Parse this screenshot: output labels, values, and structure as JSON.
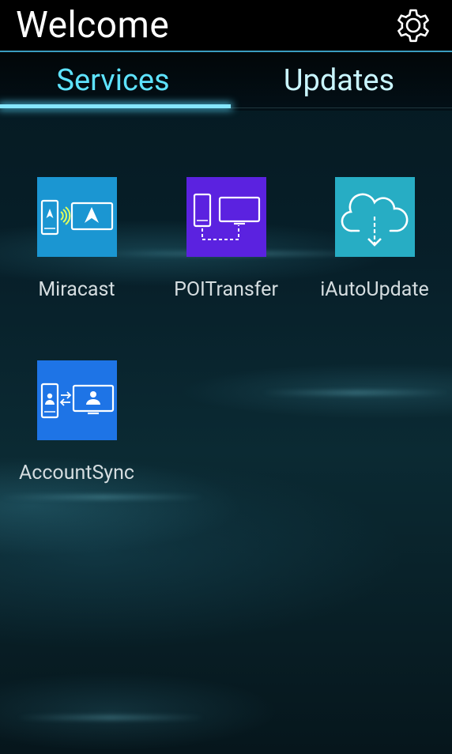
{
  "header": {
    "title": "Welcome",
    "settings_icon": "gear-icon"
  },
  "tabs": [
    {
      "label": "Services",
      "selected": true
    },
    {
      "label": "Updates",
      "selected": false
    }
  ],
  "services": [
    {
      "label": "Miracast",
      "icon": "miracast-icon",
      "color": "#1b96d2"
    },
    {
      "label": "POITransfer",
      "icon": "poi-transfer-icon",
      "color": "#5b22e0"
    },
    {
      "label": "iAutoUpdate",
      "icon": "cloud-download-icon",
      "color": "#27adc4"
    },
    {
      "label": "AccountSync",
      "icon": "account-sync-icon",
      "color": "#1e74e6"
    }
  ],
  "colors": {
    "accent": "#5ee3ff",
    "header_line": "#3a9cc0",
    "tab_indicator": "#86e7ff"
  }
}
